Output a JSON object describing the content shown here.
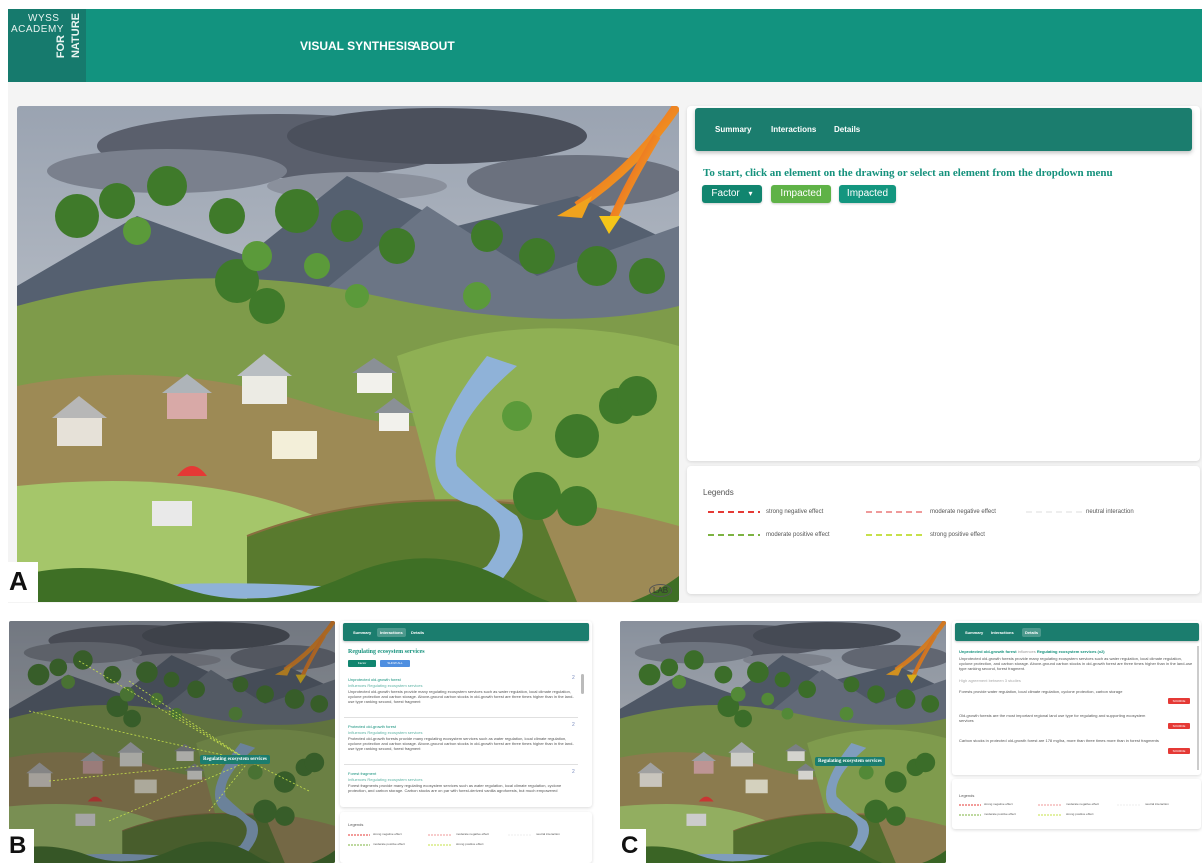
{
  "header": {
    "logo": {
      "line1": "WYSS",
      "line2": "ACADEMY",
      "line3": "FOR",
      "line4": "NATURE"
    },
    "nav": [
      {
        "label": "VISUAL SYNTHESIS"
      },
      {
        "label": "ABOUT"
      }
    ]
  },
  "panel_labels": {
    "a": "A",
    "b": "B",
    "c": "C"
  },
  "drawing": {
    "signature": "LAB"
  },
  "sidepanel": {
    "tabs": [
      {
        "label": "Summary"
      },
      {
        "label": "Interactions"
      },
      {
        "label": "Details"
      }
    ],
    "instruction": "To start, click an element on the drawing or select an element from the dropdown menu",
    "factor_button": "Factor",
    "impacted_button_1": "Impacted",
    "impacted_button_2": "Impacted"
  },
  "legend": {
    "title": "Legends",
    "items": [
      {
        "label": "strong negative effect",
        "color": "#e53935"
      },
      {
        "label": "moderate negative effect",
        "color": "#ef9a9a"
      },
      {
        "label": "neutral interaction",
        "color": "#eeeeee"
      },
      {
        "label": "moderate positive effect",
        "color": "#7cb342"
      },
      {
        "label": "strong positive effect",
        "color": "#c6e04a"
      }
    ]
  },
  "panel_b": {
    "tabs": [
      {
        "label": "Summary"
      },
      {
        "label": "Interactions"
      },
      {
        "label": "Details"
      }
    ],
    "title": "Regulating ecosystem services",
    "factor_button": "Factor",
    "show_all_button": "SHOW ALL",
    "bubble": "Regulating ecosystem services",
    "cards": [
      {
        "title": "Unprotected old-growth forest",
        "sub": "Influences Regulating ecosystem services",
        "count": "2",
        "text": "Unprotected old-growth forests provide many regulating ecosystem services such as water regulation, local climate regulation, cyclone protection and carbon storage. Above-ground carbon stocks in old-growth forest are three times higher than in the land-use type ranking second, forest fragment"
      },
      {
        "title": "Protected old-growth forest",
        "sub": "Influences Regulating ecosystem services",
        "count": "2",
        "text": "Protected old-growth forests provide many regulating ecosystem services such as water regulation, local climate regulation, cyclone protection and carbon storage. Above-ground carbon stocks in old-growth forest are three times higher than in the land-use type ranking second, forest fragment"
      },
      {
        "title": "Forest fragment",
        "sub": "Influences Regulating ecosystem services",
        "count": "2",
        "text": "Forest fragments provide many regulating ecosystem services such as water regulation, local climate regulation, cyclone protection, and carbon storage. Carbon stocks are on par with forest-derived vanilla agroforests, but much empowered"
      }
    ],
    "legend_title": "Legends",
    "legend_labels": [
      "strong negative effect",
      "moderate negative effect",
      "neutral interaction",
      "moderate positive effect",
      "strong positive effect"
    ]
  },
  "panel_c": {
    "tabs": [
      {
        "label": "Summary"
      },
      {
        "label": "Interactions"
      },
      {
        "label": "Details"
      }
    ],
    "heading_factor": "Unprotected old-growth forest",
    "heading_mid": "influences",
    "heading_target": "Regulating ecosystem services (x2)",
    "intro": "Unprotected old-growth forests provide many regulating ecosystem services such as water regulation, local climate regulation, cyclone protection, and carbon storage. Above-ground carbon stocks in old-growth forest are three times higher than in the land-use type ranking second, forest fragment.",
    "agreement": "High agreement between 3 studies",
    "bubble": "Regulating ecosystem services",
    "statements": [
      {
        "text": "Forests provide water regulation, local climate regulation, cyclone protection, carbon storage",
        "button": "SOURCE"
      },
      {
        "text": "Old-growth forests are the most important regional land use type for regulating and supporting ecosystem services",
        "button": "SOURCE"
      },
      {
        "text": "Carbon stocks in protected old-growth forest are 178 mg/ha, more than three times more than in forest fragments",
        "button": "SOURCE"
      }
    ],
    "legend_title": "Legends",
    "legend_labels": [
      "strong negative effect",
      "moderate negative effect",
      "neutral interaction",
      "moderate positive effect",
      "strong positive effect"
    ]
  }
}
